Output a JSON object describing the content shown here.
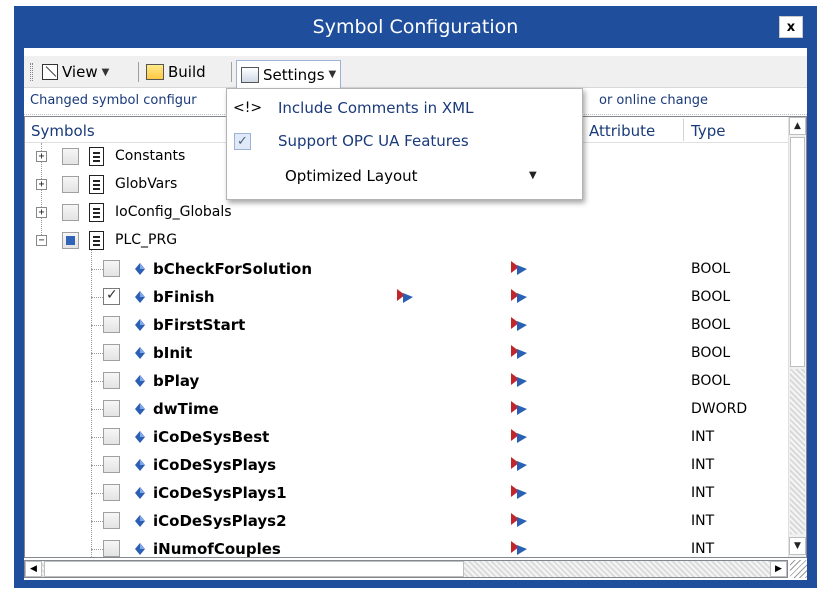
{
  "window": {
    "title": "Symbol Configuration",
    "close_label": "x"
  },
  "toolbar": {
    "view_label": "View",
    "build_label": "Build",
    "settings_label": "Settings"
  },
  "info_bar": {
    "left_text": "Changed symbol configur",
    "right_text": "or online change"
  },
  "grid": {
    "headers": {
      "symbols": "Symbols",
      "attribute": "Attribute",
      "type": "Type"
    },
    "nodes": [
      {
        "label": "Constants",
        "expander": "+",
        "check": "unchecked"
      },
      {
        "label": "GlobVars",
        "expander": "+",
        "check": "unchecked"
      },
      {
        "label": "IoConfig_Globals",
        "expander": "+",
        "check": "unchecked"
      },
      {
        "label": "PLC_PRG",
        "expander": "−",
        "check": "partial"
      }
    ],
    "variables": [
      {
        "name": "bCheckForSolution",
        "type": "BOOL",
        "checked": false,
        "extra_icon": false
      },
      {
        "name": "bFinish",
        "type": "BOOL",
        "checked": true,
        "extra_icon": true
      },
      {
        "name": "bFirstStart",
        "type": "BOOL",
        "checked": false,
        "extra_icon": false
      },
      {
        "name": "bInit",
        "type": "BOOL",
        "checked": false,
        "extra_icon": false
      },
      {
        "name": "bPlay",
        "type": "BOOL",
        "checked": false,
        "extra_icon": false
      },
      {
        "name": "dwTime",
        "type": "DWORD",
        "checked": false,
        "extra_icon": false
      },
      {
        "name": "iCoDeSysBest",
        "type": "INT",
        "checked": false,
        "extra_icon": false
      },
      {
        "name": "iCoDeSysPlays",
        "type": "INT",
        "checked": false,
        "extra_icon": false
      },
      {
        "name": "iCoDeSysPlays1",
        "type": "INT",
        "checked": false,
        "extra_icon": false
      },
      {
        "name": "iCoDeSysPlays2",
        "type": "INT",
        "checked": false,
        "extra_icon": false
      },
      {
        "name": "iNumofCouples",
        "type": "INT",
        "checked": false,
        "extra_icon": false
      }
    ]
  },
  "settings_menu": {
    "include_comments_icon": "<!>",
    "include_comments_label": "Include Comments in XML",
    "support_opc_label": "Support OPC UA Features",
    "support_opc_checked": true,
    "optimized_layout_label": "Optimized Layout"
  },
  "colors": {
    "title_bar": "#1f4e9c",
    "link_text": "#1a3a7a",
    "checkbox_partial": "#2f64b8"
  },
  "icons": {
    "view": "view-icon",
    "build": "build-icon",
    "settings": "settings-icon",
    "document": "document-icon",
    "variable": "variable-icon",
    "access": "access-icon"
  }
}
